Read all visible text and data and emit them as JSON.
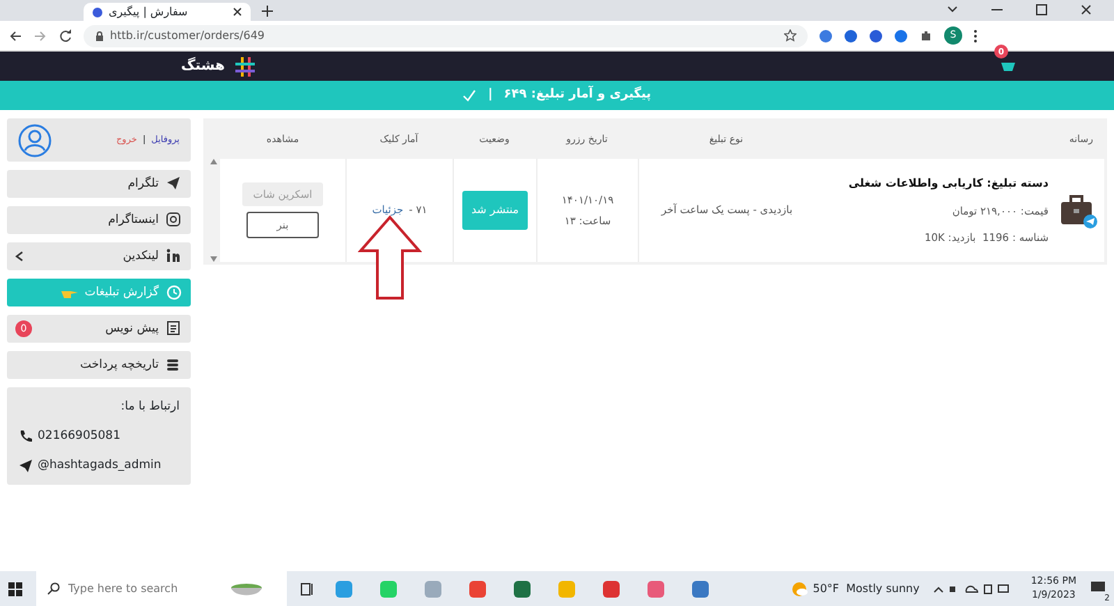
{
  "browser": {
    "tab_title": "سفارش | پیگیری",
    "url": "httb.ir/customer/orders/649",
    "profile_initial": "S"
  },
  "header": {
    "brand": "هشتگ",
    "cart_count": "0"
  },
  "banner": {
    "title": "پیگیری و آمار تبلیغ: ۶۴۹",
    "separator": "|"
  },
  "sidebar": {
    "profile_link": "پروفایل",
    "divider": "|",
    "logout_link": "خروج",
    "items": [
      {
        "label": "تلگرام",
        "selected": false,
        "has_submenu": false
      },
      {
        "label": "اینستاگرام",
        "selected": false,
        "has_submenu": false
      },
      {
        "label": "لینکدین",
        "selected": false,
        "has_submenu": true
      },
      {
        "label": "گزارش تبلیغات",
        "selected": true,
        "has_submenu": false
      },
      {
        "label": "پیش نویس",
        "selected": false,
        "has_submenu": false,
        "badge": "0"
      },
      {
        "label": "تاریخچه پرداخت",
        "selected": false,
        "has_submenu": false
      }
    ],
    "contact": {
      "title": "ارتباط با ما:",
      "phone": "02166905081",
      "telegram": "@hashtagads_admin"
    }
  },
  "table": {
    "columns": [
      "رسانه",
      "نوع تبلیغ",
      "تاریخ رزرو",
      "وضعیت",
      "آمار کلیک",
      "مشاهده"
    ],
    "rows": [
      {
        "category": "دسته تبلیغ: کاریابی واطلاعات شغلی",
        "price": "قیمت: ۲۱۹,۰۰۰ تومان",
        "stats": "شناسه : 1196  بازدید: 10K",
        "ad_type": "بازدیدی - پست یک ساعت آخر",
        "date": "۱۴۰۱/۱۰/۱۹",
        "time": "ساعت: ۱۳",
        "status": "منتشر شد",
        "clicks": "۷۱ -",
        "details_link": "جزئیات",
        "screenshot_button": {
          "label": "اسکرین شات",
          "disabled": true
        },
        "banner_button": {
          "label": "بنر",
          "disabled": false
        }
      }
    ]
  },
  "taskbar": {
    "search_placeholder": "Type here to search",
    "weather": "50°F  Mostly sunny",
    "time": "12:56 PM",
    "date": "1/9/2023",
    "notifications": "2"
  }
}
